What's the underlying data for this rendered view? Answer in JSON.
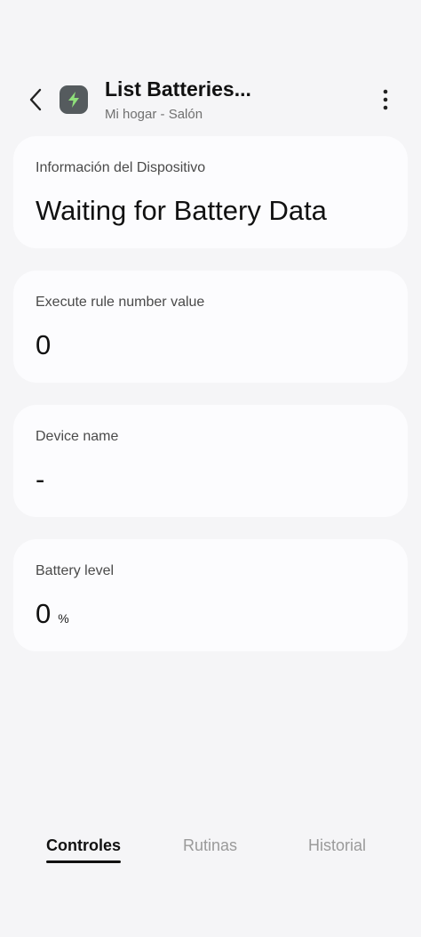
{
  "header": {
    "title": "List Batteries...",
    "subtitle": "Mi hogar - Salón",
    "icons": {
      "back": "chevron-left-icon",
      "device": "lightning-bolt-icon",
      "more": "more-vertical-icon"
    },
    "device_icon_bg": "#555b5e",
    "device_icon_color": "#8fe07a"
  },
  "cards": [
    {
      "label": "Información del Dispositivo",
      "value": "Waiting for Battery Data"
    },
    {
      "label": "Execute rule number value",
      "value": "0"
    },
    {
      "label": "Device name",
      "value": "-"
    },
    {
      "label": "Battery level",
      "value": "0",
      "unit": "%"
    }
  ],
  "tabs": [
    {
      "label": "Controles",
      "active": true
    },
    {
      "label": "Rutinas",
      "active": false
    },
    {
      "label": "Historial",
      "active": false
    }
  ]
}
